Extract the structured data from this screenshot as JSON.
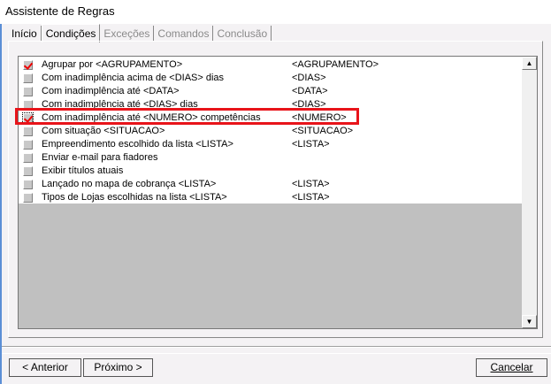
{
  "window": {
    "title": "Assistente de Regras"
  },
  "tabs": [
    {
      "label": "Início",
      "state": "enabled"
    },
    {
      "label": "Condições",
      "state": "active"
    },
    {
      "label": "Exceções",
      "state": "disabled"
    },
    {
      "label": "Comandos",
      "state": "disabled"
    },
    {
      "label": "Conclusão",
      "state": "disabled"
    }
  ],
  "rules": [
    {
      "label": "Agrupar por <AGRUPAMENTO>",
      "param": "<AGRUPAMENTO>",
      "checked": true
    },
    {
      "label": "Com inadimplência acima de <DIAS> dias",
      "param": "<DIAS>",
      "checked": false
    },
    {
      "label": "Com inadimplência até <DATA>",
      "param": "<DATA>",
      "checked": false
    },
    {
      "label": "Com inadimplência até <DIAS>  dias",
      "param": "<DIAS>",
      "checked": false
    },
    {
      "label": "Com inadimplência até <NUMERO> competências",
      "param": "<NUMERO>",
      "checked": true,
      "highlighted": true
    },
    {
      "label": "Com situação <SITUACAO>",
      "param": "<SITUACAO>",
      "checked": false
    },
    {
      "label": "Empreendimento escolhido da lista <LISTA>",
      "param": "<LISTA>",
      "checked": false
    },
    {
      "label": "Enviar e-mail para fiadores",
      "param": "",
      "checked": false
    },
    {
      "label": "Exibir títulos atuais",
      "param": "",
      "checked": false
    },
    {
      "label": "Lançado no mapa de cobrança <LISTA>",
      "param": "<LISTA>",
      "checked": false
    },
    {
      "label": "Tipos de Lojas escolhidas na lista <LISTA>",
      "param": "<LISTA>",
      "checked": false
    }
  ],
  "buttons": {
    "back": "< Anterior",
    "next": "Próximo >",
    "cancel": "Cancelar"
  },
  "colors": {
    "highlight": "#e8141a",
    "check": "#e00000"
  }
}
